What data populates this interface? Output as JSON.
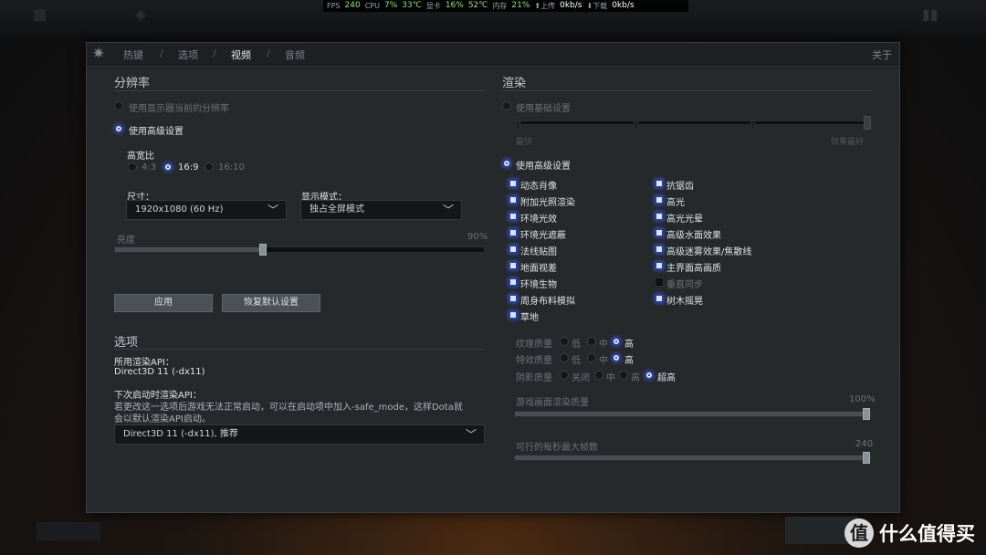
{
  "overlay": {
    "fps_label": "FPS",
    "fps": "240",
    "cpu_label": "CPU",
    "cpu_usage": "7%",
    "cpu_temp": "33℃",
    "gpu_label": "显卡",
    "gpu_usage": "16%",
    "gpu_temp": "52℃",
    "mem_label": "内存",
    "mem_usage": "21%",
    "up_label": "上传",
    "up_speed": "0kb/s",
    "down_label": "下载",
    "down_speed": "0kb/s"
  },
  "tabs": {
    "hotkeys": "热键",
    "options": "选项",
    "video": "视频",
    "audio": "音频",
    "separator": "/",
    "about": "关于"
  },
  "resolution": {
    "heading": "分辨率",
    "use_display": "使用显示器当前的分辨率",
    "use_advanced": "使用高级设置",
    "aspect_label": "高宽比",
    "aspect_options": [
      "4:3",
      "16:9",
      "16:10"
    ],
    "aspect_selected": "16:9",
    "size_label": "尺寸：",
    "size_value": "1920x1080 (60 Hz)",
    "display_mode_label": "显示模式：",
    "display_mode_value": "独占全屏模式",
    "brightness_label": "亮度",
    "brightness_value": "90%",
    "brightness_level": 0.4,
    "apply": "应用",
    "restore": "恢复默认设置"
  },
  "options": {
    "heading": "选项",
    "api_label": "所用渲染API：",
    "api_value": "Direct3D 11 (-dx11)",
    "next_label": "下次启动时渲染API：",
    "note_line1": "若更改这一选项后游戏无法正常启动，可以在启动项中加入-safe_mode，这样Dota就",
    "note_line2": "会以默认渲染API启动。",
    "api_select": "Direct3D 11 (-dx11), 推荐"
  },
  "render": {
    "heading": "渲染",
    "use_basic": "使用基础设置",
    "basic_left": "最快",
    "basic_right": "效果最好",
    "use_advanced": "使用高级设置",
    "left_checks": [
      "动态肖像",
      "附加光照渲染",
      "环境光效",
      "环境光遮蔽",
      "法线贴图",
      "地面视差",
      "环境生物",
      "周身布料模拟",
      "草地"
    ],
    "right_checks": [
      {
        "label": "抗锯齿",
        "on": true
      },
      {
        "label": "高光",
        "on": true
      },
      {
        "label": "高光光晕",
        "on": true
      },
      {
        "label": "高级水面效果",
        "on": true
      },
      {
        "label": "高级迷雾效果/焦散线",
        "on": true
      },
      {
        "label": "主界面高画质",
        "on": true
      },
      {
        "label": "垂直同步",
        "on": false
      },
      {
        "label": "树木摇晃",
        "on": true
      }
    ],
    "texture_label": "纹理质量",
    "effects_label": "特效质量",
    "shadow_label": "阴影质量",
    "q_low": "低",
    "q_mid": "中",
    "q_high": "高",
    "shadow_off": "关闭",
    "shadow_ultra": "超高",
    "texture_selected": "高",
    "effects_selected": "高",
    "shadow_selected": "超高",
    "render_quality_label": "游戏画面渲染质量",
    "render_quality_value": "100%",
    "render_quality_level": 1.0,
    "max_fps_label": "可行的每秒最大帧数",
    "max_fps_value": "240",
    "max_fps_level": 1.0
  },
  "watermark": {
    "logo": "值",
    "text": "什么值得买"
  }
}
